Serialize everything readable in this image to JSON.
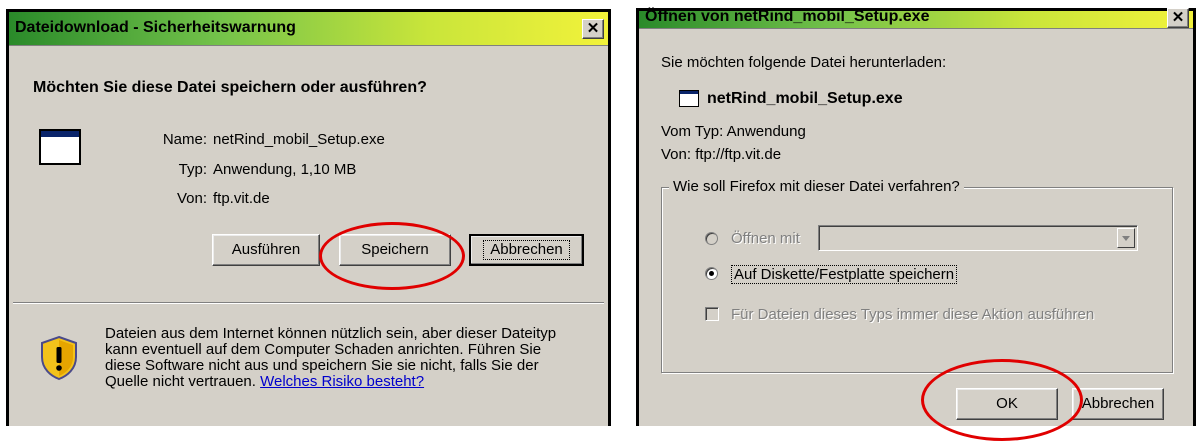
{
  "dialog1": {
    "title": "Dateidownload - Sicherheitswarnung",
    "close_glyph": "✕",
    "question": "Möchten Sie diese Datei speichern oder ausführen?",
    "name_label": "Name:",
    "name_value": "netRind_mobil_Setup.exe",
    "type_label": "Typ:",
    "type_value": "Anwendung, 1,10 MB",
    "from_label": "Von:",
    "from_value": "ftp.vit.de",
    "buttons": {
      "run": "Ausführen",
      "save": "Speichern",
      "cancel": "Abbrechen"
    },
    "warning_lines": [
      "Dateien aus dem Internet können nützlich sein, aber dieser Dateityp",
      "kann eventuell auf dem Computer Schaden anrichten. Führen Sie",
      "diese Software nicht aus und speichern Sie sie nicht, falls Sie der"
    ],
    "warning_last_line": "Quelle nicht vertrauen.",
    "risk_link": "Welches Risiko besteht?"
  },
  "dialog2": {
    "title": "Öffnen von netRind_mobil_Setup.exe",
    "close_glyph": "✕",
    "intro": "Sie möchten folgende Datei herunterladen:",
    "filename": "netRind_mobil_Setup.exe",
    "type_line": "Vom Typ: Anwendung",
    "from_line": "Von: ftp://ftp.vit.de",
    "group_legend": "Wie soll Firefox mit dieser Datei verfahren?",
    "open_with_label": "Öffnen mit",
    "save_disk_label": "Auf Diskette/Festplatte speichern",
    "always_label": "Für Dateien dieses Typs immer diese Aktion ausführen",
    "selected_option": "Auf Diskette/Festplatte speichern",
    "buttons": {
      "ok": "OK",
      "cancel": "Abbrechen"
    }
  },
  "colors": {
    "titlebar_gradient": [
      "#2a8a2a",
      "#73c24a",
      "#f2f23a"
    ],
    "dialog_bg": "#d4d0c8",
    "highlight_circle": "#e00000",
    "link": "#0000cc"
  },
  "icons": [
    "application-icon",
    "security-shield-icon",
    "close-icon",
    "dropdown-arrow-icon"
  ]
}
